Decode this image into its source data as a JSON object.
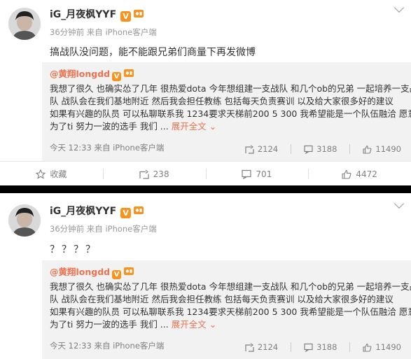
{
  "posts": [
    {
      "author": "iG_月夜枫YYF",
      "verified_badge": "V",
      "meta": "36分钟前 来自 iPhone客户端",
      "content": "搞战队没问题，能不能跟兄弟们商量下再发微博",
      "repost": {
        "author": "@黄翔longdd",
        "verified_badge": "V",
        "lines": [
          "我想了很久 也确实怂了几年 很热爱dota 今年想组建一支战队 和几个ob的兄弟 一起培养一支战",
          "队  战队会在我们基地附近 然后我会担任教练 包括每天负责赛训 以及给大家很多好的建议",
          "如果有兴趣的队员 可以私聊联系我 1234要求天梯前200 5 300  我希望能是一个队伍融洽 愿意",
          "为了ti 努力一波的选手 我们 ..."
        ],
        "expand": "展开全文",
        "time": "今天 12:33 来自 iPhone客户端",
        "reposts": "2124",
        "comments": "3188",
        "likes": "11490"
      },
      "actions": {
        "favorite": "收藏",
        "repost": "238",
        "comment": "701",
        "like": "4472"
      }
    },
    {
      "author": "iG_月夜枫YYF",
      "verified_badge": "V",
      "meta": "36分钟前 来自 iPhone客户端",
      "content": "？？？？",
      "repost": {
        "author": "@黄翔longdd",
        "verified_badge": "V",
        "lines": [
          "我想了很久 也确实怂了几年 很热爱dota 今年想组建一支战队 和几个ob的兄弟 一起培养一支战",
          "队  战队会在我们基地附近 然后我会担任教练 包括每天负责赛训 以及给大家很多好的建议",
          "如果有兴趣的队员 可以私聊联系我 1234要求天梯前200 5 300  我希望能是一个队伍融洽 愿意",
          "为了ti 努力一波的选手 我们 ..."
        ],
        "expand": "展开全文",
        "time": "今天 12:33 来自 iPhone客户端",
        "reposts": "2124",
        "comments": "3188",
        "likes": "11490"
      }
    }
  ]
}
